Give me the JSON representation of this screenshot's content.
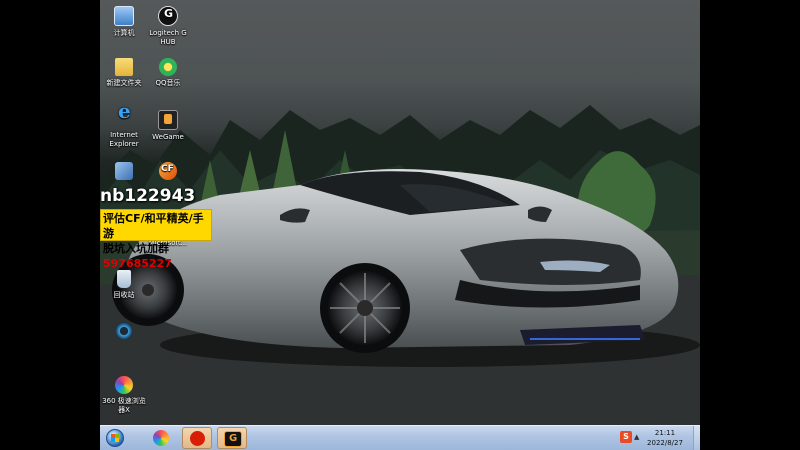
{
  "desktop": {
    "icons": [
      {
        "label": "计算机",
        "icon": "computer-icon"
      },
      {
        "label": "Logitech G\nHUB",
        "icon": "logitech-ghub-icon"
      },
      {
        "label": "新建文件夹",
        "icon": "folder-icon"
      },
      {
        "label": "QQ音乐",
        "icon": "qq-music-icon"
      },
      {
        "label": "Internet\nExplorer",
        "icon": "internet-explorer-icon"
      },
      {
        "label": "WeGame",
        "icon": "wegame-icon"
      },
      {
        "label": "",
        "icon": "app-icon"
      },
      {
        "label": "",
        "icon": "crossfire-icon"
      },
      {
        "label": "Microsoft...",
        "icon": "microsoft-app-icon"
      },
      {
        "label": "回收站",
        "icon": "recycle-bin-icon"
      },
      {
        "label": "",
        "icon": "accelerator-icon"
      },
      {
        "label": "360 极速浏览\n器X",
        "icon": "360-browser-icon"
      }
    ]
  },
  "overlay": {
    "id_text": "nb122943",
    "line1": "评估CF/和平精英/手游",
    "line2_prefix": "脱坑入坑加群",
    "line2_qq": "597685227"
  },
  "taskbar": {
    "start_label": "Start",
    "pinned": [
      {
        "name": "360-browser-taskbar",
        "icon": "360-icon"
      },
      {
        "name": "netease-music-taskbar",
        "icon": "netease-music-icon"
      },
      {
        "name": "ghub-taskbar",
        "icon": "g-icon"
      }
    ],
    "tray_ime": "S",
    "clock_time": "21:11",
    "clock_date": "2022/8/27"
  },
  "colors": {
    "taskbar": "#aec4e3",
    "promo_bg": "#ffd800",
    "promo_qq": "#e00000"
  }
}
